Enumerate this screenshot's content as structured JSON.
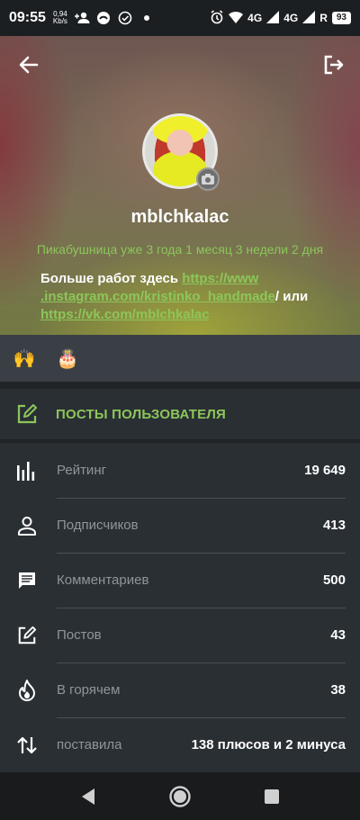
{
  "status_bar": {
    "time": "09:55",
    "speed_value": "0,94",
    "speed_unit": "Kb/s",
    "network_1": "4G",
    "network_2": "4G",
    "roaming": "R",
    "battery": "93"
  },
  "header": {
    "username": "mblchkalac",
    "tenure": "Пикабушница уже 3 года 1 месяц 3 недели 2 дня",
    "bio_text": "Больше работ здесь ",
    "bio_link_1": "https://www .instagram.com/kristinko_handmade",
    "bio_between": "/ или ",
    "bio_link_2": "https://vk.com/mblchkalac"
  },
  "awards": [
    {
      "icon": "hands-award-icon",
      "glyph": "🙌"
    },
    {
      "icon": "cake-award-icon",
      "glyph": "🎂"
    }
  ],
  "posts_button": {
    "label": "ПОСТЫ ПОЛЬЗОВАТЕЛЯ"
  },
  "stats": [
    {
      "icon": "rating-bars-icon",
      "name": "Рейтинг",
      "value": "19 649"
    },
    {
      "icon": "person-icon",
      "name": "Подписчиков",
      "value": "413"
    },
    {
      "icon": "comment-icon",
      "name": "Комментариев",
      "value": "500"
    },
    {
      "icon": "edit-icon",
      "name": "Постов",
      "value": "43"
    },
    {
      "icon": "flame-icon",
      "name": "В горячем",
      "value": "38"
    },
    {
      "icon": "swap-vertical-icon",
      "name": "поставила",
      "value": "138 плюсов и 2 минуса"
    }
  ],
  "colors": {
    "accent_green": "#8cc65a",
    "background": "#202427",
    "panel": "#2a2f34"
  }
}
